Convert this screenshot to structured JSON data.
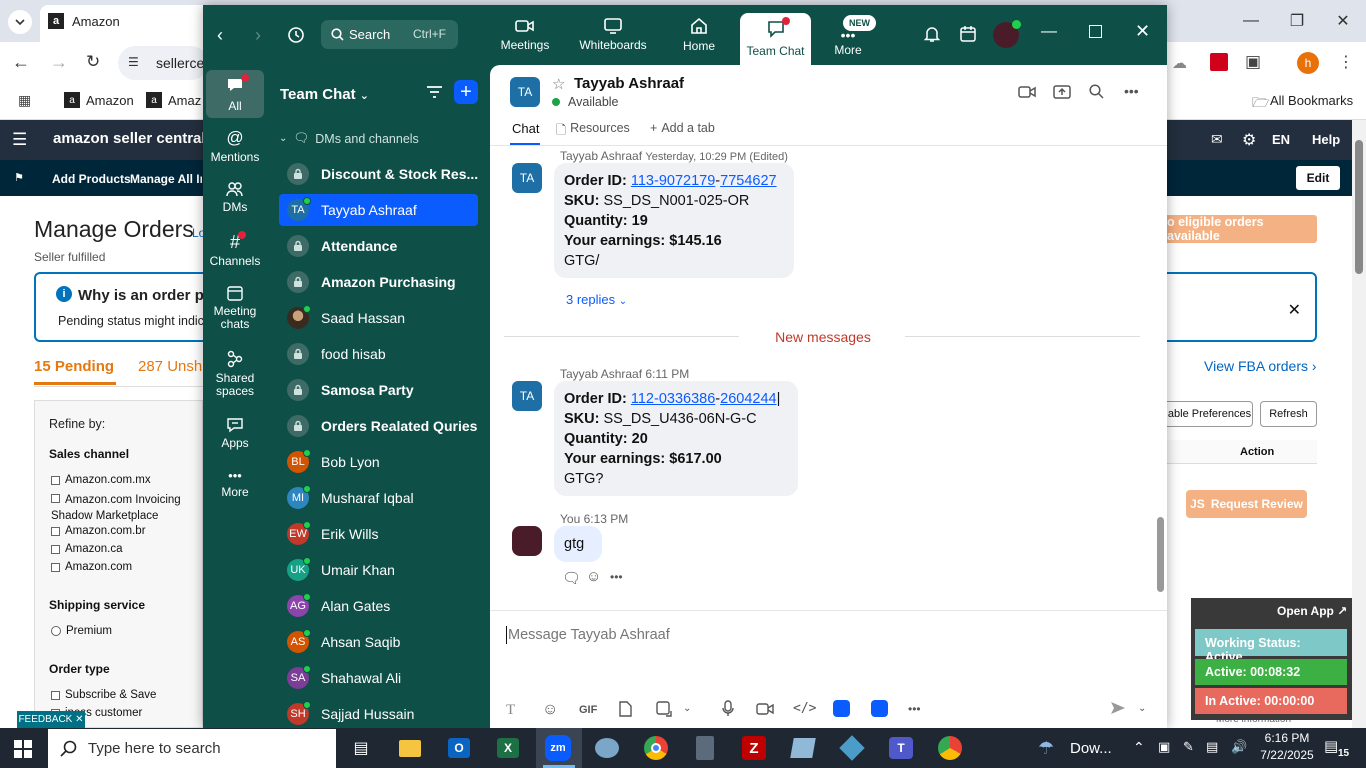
{
  "chrome": {
    "tab_title": "Amazon",
    "omnibox_text": "sellerce",
    "bookmarks": [
      "Amazon",
      "Amaz"
    ],
    "all_bookmarks": "All Bookmarks",
    "profile_initial": "h"
  },
  "amazon": {
    "brand": "amazon seller central",
    "nav_right": {
      "lang": "EN",
      "help": "Help"
    },
    "subnav": {
      "add_products": "Add Products",
      "manage": "Manage All Inve",
      "edit": "Edit"
    },
    "page_title": "Manage Orders",
    "page_title_suffix": "Lo",
    "seller_fulfilled": "Seller fulfilled",
    "no_eligible": "o eligible orders available",
    "info_title": "Why is an order pe",
    "info_text": "Pending status might indicat",
    "tab_pending": "15 Pending",
    "tab_unship": "287 Unshi",
    "view_fba": "View FBA orders",
    "table_prefs": "able Preferences",
    "refresh": "Refresh",
    "action": "Action",
    "request_review": "Request Review",
    "more_info": "More information",
    "refine_by": "Refine by:",
    "sales_channel": "Sales channel",
    "channels": [
      "Amazon.com.mx",
      "Amazon.com Invoicing Shadow Marketplace",
      "Amazon.com.br",
      "Amazon.ca",
      "Amazon.com"
    ],
    "shipping_service": "Shipping service",
    "shipping_options": [
      "Premium"
    ],
    "order_type": "Order type",
    "order_types": [
      "Subscribe & Save",
      "iness customer"
    ],
    "feedback": "FEEDBACK"
  },
  "zoom": {
    "search_label": "Search",
    "search_shortcut": "Ctrl+F",
    "top_nav": [
      {
        "label": "Meetings"
      },
      {
        "label": "Whiteboards"
      },
      {
        "label": "Home"
      },
      {
        "label": "Team Chat"
      },
      {
        "label": "More",
        "badge": "NEW"
      }
    ],
    "rail": [
      {
        "label": "All"
      },
      {
        "label": "Mentions"
      },
      {
        "label": "DMs"
      },
      {
        "label": "Channels"
      },
      {
        "label": "Meeting chats"
      },
      {
        "label": "Shared spaces"
      },
      {
        "label": "Apps"
      },
      {
        "label": "More"
      }
    ],
    "list_title": "Team Chat",
    "section_label": "DMs and channels",
    "conversations": [
      {
        "name": "Discount & Stock Res...",
        "initials": "",
        "type": "lock",
        "bold": true,
        "color": "#3e6b65"
      },
      {
        "name": "Tayyab Ashraaf",
        "initials": "TA",
        "type": "person",
        "bold": false,
        "color": "#1d6fa5",
        "selected": true
      },
      {
        "name": "Attendance",
        "initials": "",
        "type": "lock",
        "bold": true,
        "color": "#3e6b65"
      },
      {
        "name": "Amazon Purchasing",
        "initials": "",
        "type": "lock",
        "bold": true,
        "color": "#3e6b65"
      },
      {
        "name": "Saad Hassan",
        "initials": "",
        "type": "photo",
        "bold": false,
        "color": "#5a4a3a"
      },
      {
        "name": "food hisab",
        "initials": "",
        "type": "lock",
        "bold": false,
        "color": "#3e6b65"
      },
      {
        "name": "Samosa Party",
        "initials": "",
        "type": "lock",
        "bold": true,
        "color": "#3e6b65"
      },
      {
        "name": "Orders Realated Quries",
        "initials": "",
        "type": "lock",
        "bold": true,
        "color": "#3e6b65"
      },
      {
        "name": "Bob Lyon",
        "initials": "BL",
        "type": "person",
        "bold": false,
        "color": "#d35400"
      },
      {
        "name": "Musharaf Iqbal",
        "initials": "MI",
        "type": "person",
        "bold": false,
        "color": "#2e86c1"
      },
      {
        "name": "Erik Wills",
        "initials": "EW",
        "type": "person",
        "bold": false,
        "color": "#c0392b"
      },
      {
        "name": "Umair Khan",
        "initials": "UK",
        "type": "person",
        "bold": false,
        "color": "#16a085"
      },
      {
        "name": "Alan Gates",
        "initials": "AG",
        "type": "person",
        "bold": false,
        "color": "#8e44ad"
      },
      {
        "name": "Ahsan Saqib",
        "initials": "AS",
        "type": "person",
        "bold": false,
        "color": "#d35400"
      },
      {
        "name": "Shahawal Ali",
        "initials": "SA",
        "type": "person",
        "bold": false,
        "color": "#7d3c98"
      },
      {
        "name": "Sajjad Hussain",
        "initials": "SH",
        "type": "person",
        "bold": false,
        "color": "#c0392b"
      }
    ],
    "chat": {
      "contact_initials": "TA",
      "contact_name": "Tayyab Ashraaf",
      "status": "Available",
      "tabs": [
        "Chat",
        "Resources",
        "Add a tab"
      ],
      "messages": [
        {
          "author": "Tayyab Ashraaf",
          "time": "Yesterday, 10:29 PM (Edited)",
          "order_label": "Order ID:",
          "order_a": "113-9072179",
          "order_b": "7754627",
          "sku_label": "SKU:",
          "sku": "SS_DS_N001-025-OR",
          "qty_label": "Quantity:",
          "qty": "19",
          "earn_label": "Your earnings:",
          "earn": "$145.16",
          "note": "GTG/"
        },
        {
          "author": "Tayyab Ashraaf",
          "time": "6:11 PM",
          "order_label": "Order ID:",
          "order_a": "112-0336386",
          "order_b": "2604244",
          "sku_label": "SKU:",
          "sku": "SS_DS_U436-06N-G-C",
          "qty_label": "Quantity:",
          "qty": "20",
          "earn_label": "Your earnings:",
          "earn": "$617.00",
          "note": "GTG?"
        }
      ],
      "replies": "3 replies",
      "new_messages": "New messages",
      "you_label": "You",
      "you_time": "6:13 PM",
      "you_text": "gtg",
      "composer_placeholder": "Message Tayyab Ashraaf"
    }
  },
  "status_widget": {
    "open_app": "Open App",
    "working": "Working Status: Active",
    "active": "Active: 00:08:32",
    "inactive": "In Active: 00:00:00"
  },
  "taskbar": {
    "search_placeholder": "Type here to search",
    "weather": "Dow...",
    "time": "6:16 PM",
    "date": "7/22/2025",
    "notifications": "15"
  }
}
